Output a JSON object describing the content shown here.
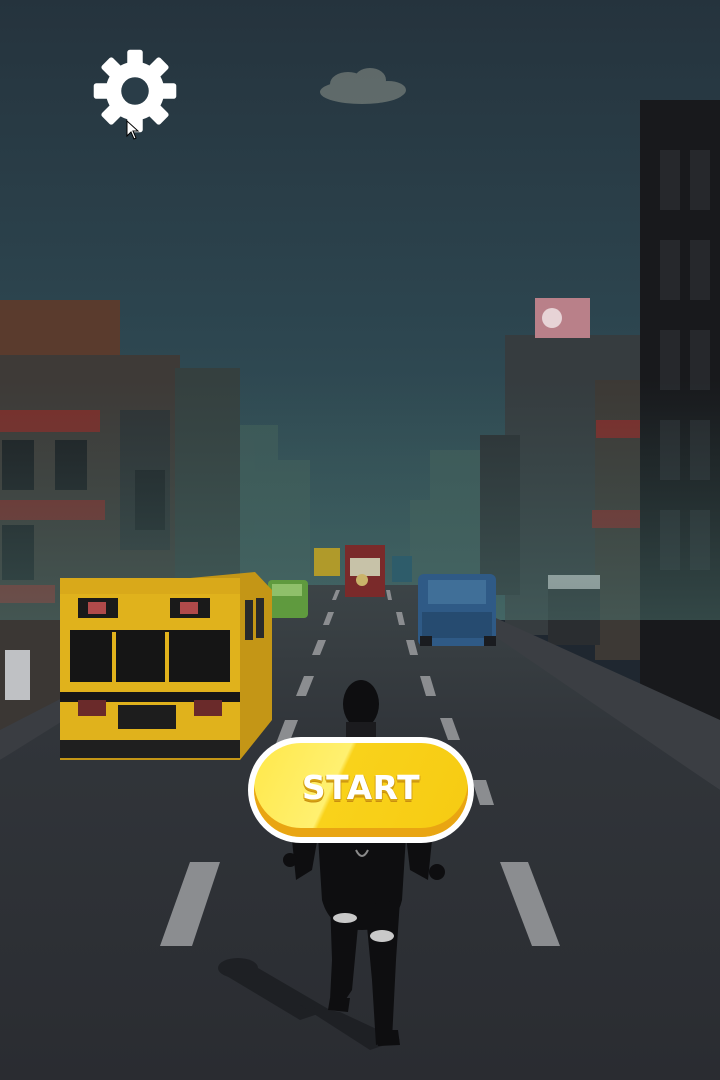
{
  "hud": {
    "settings_icon": "gear-icon",
    "start_label": "START"
  },
  "colors": {
    "sky_top": "#26343f",
    "sky_bottom": "#2e4a52",
    "road": "#2c2e33",
    "lane_marking": "#8a8c90",
    "start_button": "#f6cb12",
    "bus": "#e0b21c",
    "character": "#0d0d0f"
  }
}
